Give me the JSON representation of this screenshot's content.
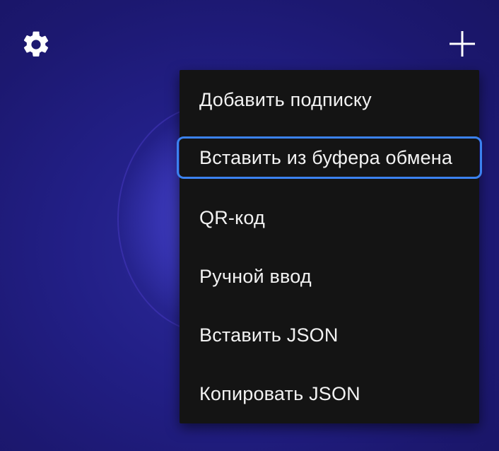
{
  "toolbar": {
    "settings_icon": "gear-icon",
    "add_icon": "plus-icon"
  },
  "menu": {
    "items": [
      {
        "label": "Добавить подписку"
      },
      {
        "label": "Вставить из буфера обмена",
        "focused": true
      },
      {
        "label": "QR-код"
      },
      {
        "label": "Ручной ввод"
      },
      {
        "label": "Вставить JSON"
      },
      {
        "label": "Копировать JSON"
      }
    ]
  },
  "colors": {
    "background": "#221f86",
    "menu_background": "#141414",
    "menu_text": "#f2f2f2",
    "focus_border": "#3b82f0"
  }
}
